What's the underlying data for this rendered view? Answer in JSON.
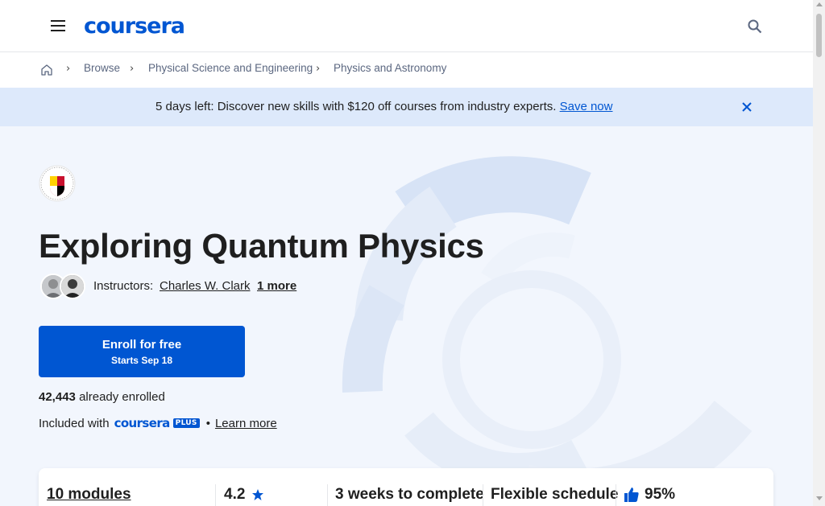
{
  "header": {
    "logo_text": "coursera",
    "menu_icon": "hamburger-menu-icon",
    "search_icon": "search-icon"
  },
  "breadcrumb": {
    "home_icon": "home-icon",
    "items": [
      {
        "label": "Browse"
      },
      {
        "label": "Physical Science and Engineering"
      },
      {
        "label": "Physics and Astronomy"
      }
    ]
  },
  "banner": {
    "text": "5 days left: Discover new skills with $120 off courses from industry experts.",
    "link": "Save now",
    "close_icon": "close-icon",
    "background": "#dde9fb"
  },
  "course": {
    "title": "Exploring Quantum Physics",
    "instructors_label": "Instructors:",
    "instructor_name": "Charles W. Clark",
    "instructor_more": "1 more",
    "enroll_label": "Enroll for free",
    "enroll_sub": "Starts Sep 18",
    "enrolled_count": "42,443",
    "enrolled_text": "already enrolled",
    "included_prefix": "Included with",
    "plus_word": "coursera",
    "plus_badge": "PLUS",
    "dot": "•",
    "learn_more": "Learn more"
  },
  "stats": {
    "modules": "10 modules",
    "rating": "4.2",
    "duration": "3 weeks to complete",
    "schedule": "Flexible schedule",
    "liked": "95%"
  },
  "colors": {
    "brand": "#0056d2",
    "hero_bg": "#f2f6fd"
  }
}
